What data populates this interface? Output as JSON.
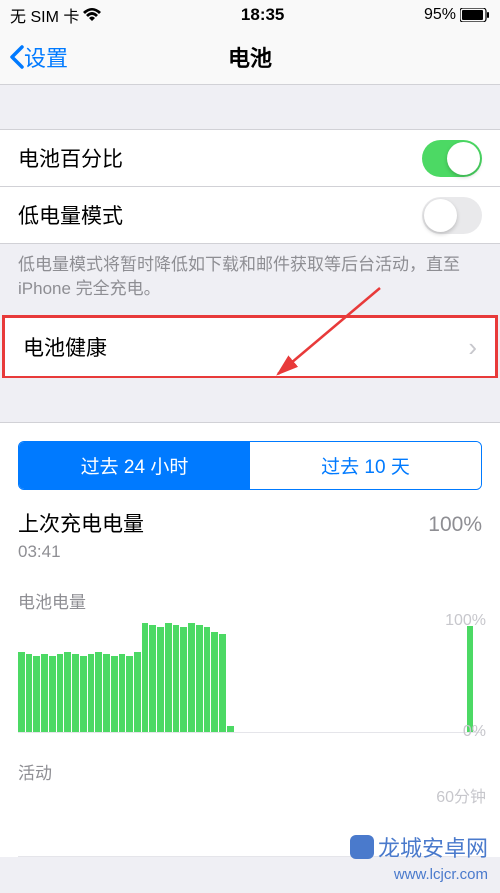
{
  "status": {
    "carrier": "无 SIM 卡",
    "time": "18:35",
    "battery": "95%"
  },
  "nav": {
    "back": "设置",
    "title": "电池"
  },
  "cells": {
    "percent": "电池百分比",
    "lowpower": "低电量模式",
    "health": "电池健康"
  },
  "footer": "低电量模式将暂时降低如下载和邮件获取等后台活动，直至 iPhone 完全充电。",
  "seg": {
    "t24h": "过去 24 小时",
    "t10d": "过去 10 天"
  },
  "charge": {
    "label": "上次充电电量",
    "pct": "100%",
    "time": "03:41"
  },
  "charts": {
    "battery_label": "电池电量",
    "battery_top": "100%",
    "battery_bot": "0%",
    "activity_label": "活动",
    "activity_top": "60分钟"
  },
  "watermark": {
    "name": "龙城安卓网",
    "url": "www.lcjcr.com"
  },
  "chart_data": {
    "type": "bar",
    "title": "电池电量",
    "values": [
      72,
      70,
      68,
      70,
      68,
      70,
      72,
      70,
      68,
      70,
      72,
      70,
      68,
      70,
      68,
      72,
      98,
      96,
      94,
      98,
      96,
      94,
      98,
      96,
      94,
      90,
      88,
      5,
      0,
      0,
      0,
      0,
      0,
      0,
      0,
      0,
      0,
      0,
      0,
      0,
      0,
      0,
      0,
      0,
      0,
      0,
      0,
      0,
      0,
      0,
      0,
      0,
      0,
      0,
      0,
      0,
      0,
      0,
      95,
      0
    ],
    "ylim": [
      0,
      100
    ],
    "ylabel": "%"
  }
}
